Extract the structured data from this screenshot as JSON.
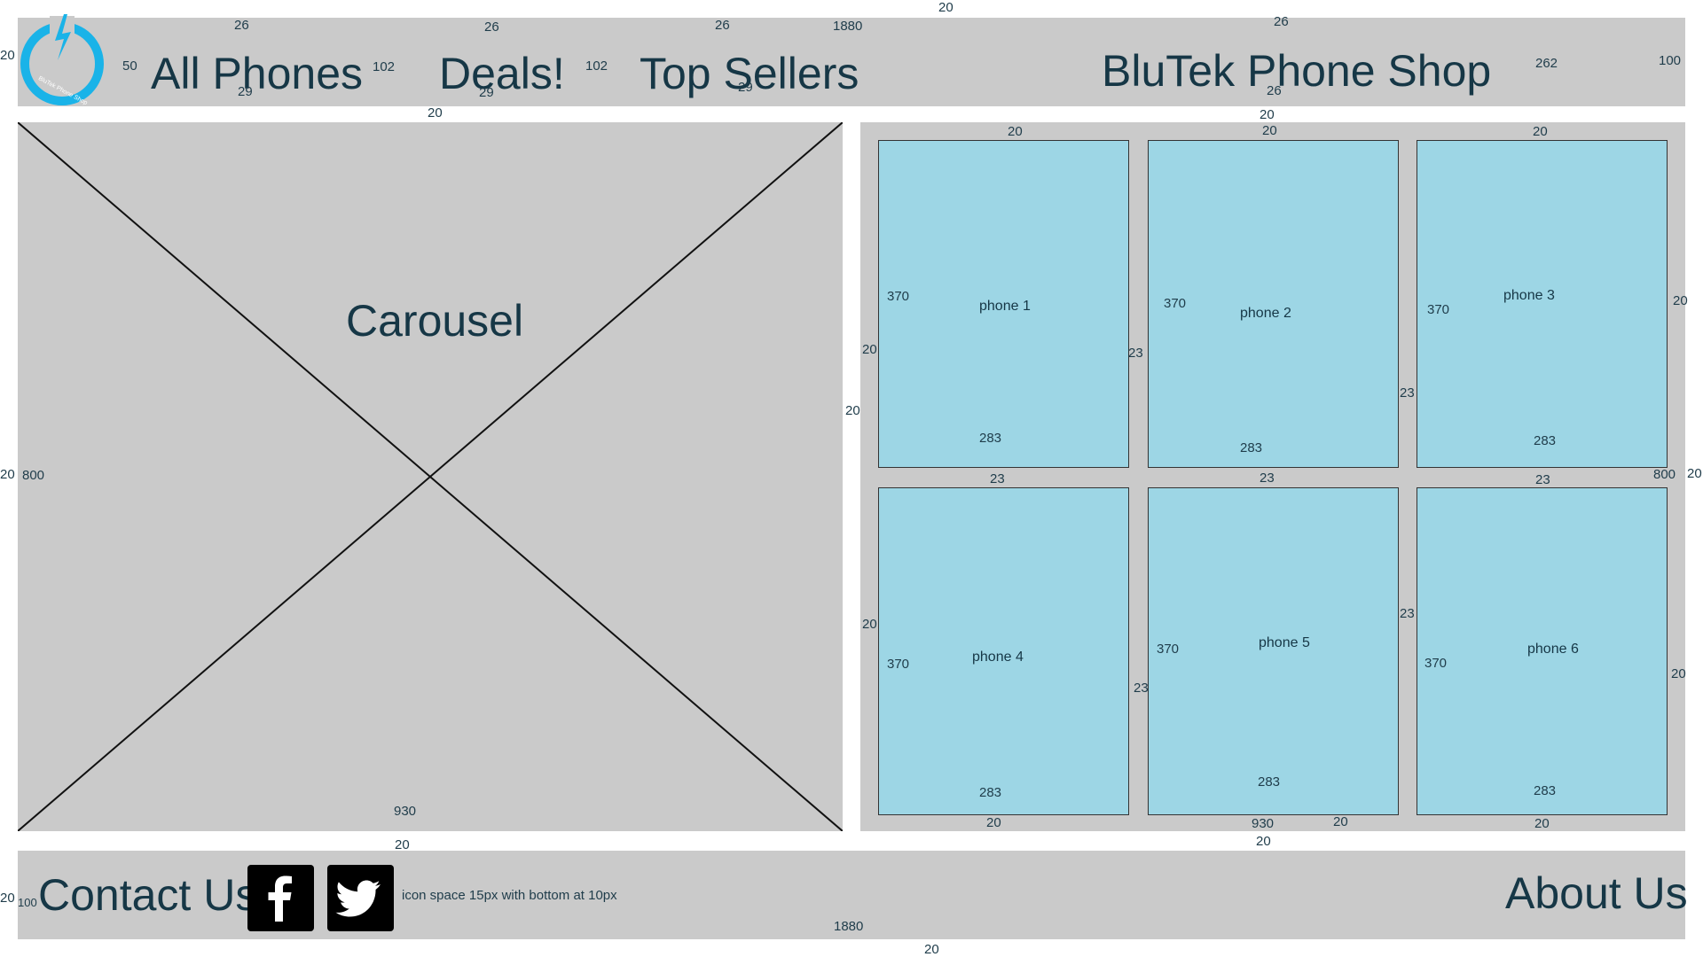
{
  "header": {
    "logo_text": "BluTek Phone Shop",
    "nav": [
      {
        "label": "All Phones"
      },
      {
        "label": "Deals!"
      },
      {
        "label": "Top Sellers"
      }
    ],
    "shop_title": "BluTek Phone Shop"
  },
  "carousel": {
    "label": "Carousel"
  },
  "phones": [
    {
      "label": "phone 1"
    },
    {
      "label": "phone 2"
    },
    {
      "label": "phone 3"
    },
    {
      "label": "phone 4"
    },
    {
      "label": "phone 5"
    },
    {
      "label": "phone 6"
    }
  ],
  "footer": {
    "contact": "Contact Us",
    "about": "About Us",
    "icon_note": "icon space 15px with bottom at 10px",
    "icons": [
      "facebook-icon",
      "twitter-icon"
    ]
  },
  "annotations": {
    "page_top": "20",
    "header_left": "20",
    "logo_gap": "50",
    "allphones_top": "26",
    "allphones_bottom": "29",
    "gap_a": "102",
    "deals_top": "26",
    "deals_bottom": "29",
    "gap_b": "102",
    "topsellers_top": "26",
    "topsellers_bottom": "29",
    "header_width": "1880",
    "title_top": "26",
    "title_bottom": "26",
    "title_right": "262",
    "header_height": "100",
    "header_gap_left": "20",
    "header_gap_right": "20",
    "carousel_left": "20",
    "carousel_height": "800",
    "carousel_width": "930",
    "carousel_bottom_gap": "20",
    "middle_gap": "20",
    "grid_top_1": "20",
    "grid_top_2": "20",
    "grid_top_3": "20",
    "grid_left_row1": "20",
    "grid_left_row2": "20",
    "grid_right_row1": "20",
    "grid_right_row2": "20",
    "grid_outer_right": "20",
    "grid_height": "800",
    "col_gap_row1_a": "23",
    "col_gap_row1_b": "23",
    "col_gap_row2_a": "23",
    "col_gap_row2_b": "23",
    "row_gap_1": "23",
    "row_gap_2": "23",
    "row_gap_3": "23",
    "card_height": "370",
    "card_width": "283",
    "grid_bottom_1": "20",
    "grid_bottom_2": "20",
    "grid_bottom_3": "20",
    "grid_width": "930",
    "grid_bottom_gap": "20",
    "footer_left": "20",
    "footer_height": "100",
    "footer_width": "1880",
    "page_bottom": "20"
  },
  "colors": {
    "panel": "#cacaca",
    "card": "#9dd6e5",
    "text": "#163746",
    "logo": "#1ab3e8"
  }
}
